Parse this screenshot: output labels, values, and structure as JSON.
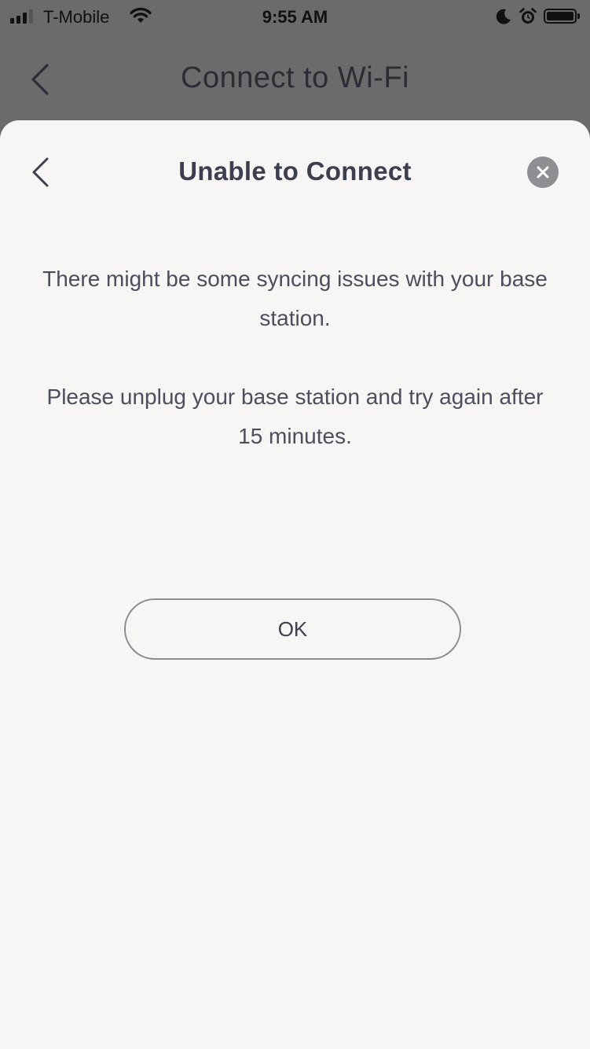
{
  "status_bar": {
    "carrier": "T-Mobile",
    "time": "9:55 AM",
    "icons": [
      "signal-icon",
      "wifi-icon",
      "moon-icon",
      "alarm-icon",
      "battery-icon"
    ]
  },
  "nav": {
    "title": "Connect to Wi-Fi",
    "back_icon": "chevron-left-icon"
  },
  "sheet": {
    "title": "Unable to Connect",
    "back_icon": "chevron-left-icon",
    "close_icon": "close-icon",
    "message_1": "There might be some syncing issues with your base station.",
    "message_2": "Please unplug your base station and try again after 15 minutes.",
    "ok_label": "OK"
  },
  "colors": {
    "overlay": "#6b6b6b",
    "sheet_background": "#f7f6f4",
    "title_text": "#3e3f4e",
    "body_text": "#4d4e5c",
    "close_button": "#8e8e93",
    "button_border": "#8c8c92"
  }
}
